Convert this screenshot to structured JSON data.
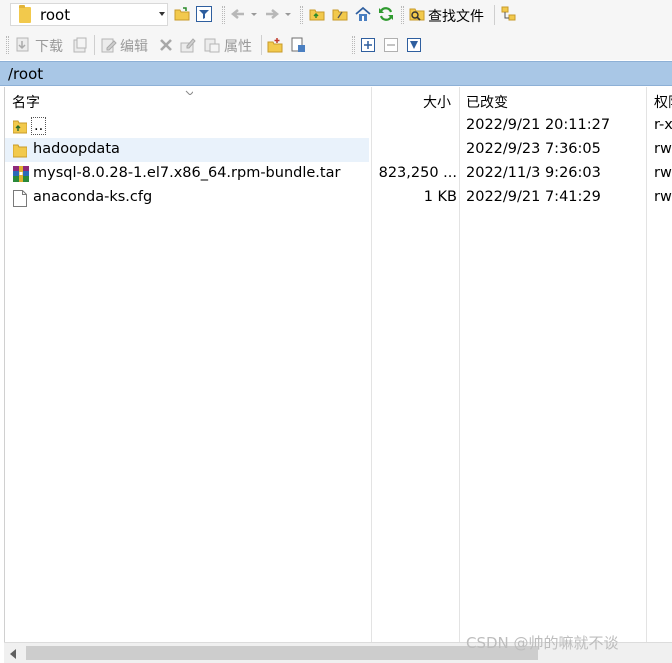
{
  "toolbar": {
    "path_value": "root",
    "find_files_label": "查找文件",
    "download_label": "下载",
    "edit_label": "编辑",
    "properties_label": "属性"
  },
  "address": {
    "path": "/root"
  },
  "columns": {
    "name": "名字",
    "size": "大小",
    "modified": "已改变",
    "permissions": "权限"
  },
  "files": [
    {
      "name": "..",
      "size": "",
      "modified": "2022/9/21 20:11:27",
      "perm": "r-x",
      "icon": "parent-folder-icon"
    },
    {
      "name": "hadoopdata",
      "size": "",
      "modified": "2022/9/23 7:36:05",
      "perm": "rw",
      "icon": "folder-icon"
    },
    {
      "name": "mysql-8.0.28-1.el7.x86_64.rpm-bundle.tar",
      "size": "823,250 ...",
      "modified": "2022/11/3 9:26:03",
      "perm": "rw",
      "icon": "archive-icon"
    },
    {
      "name": "anaconda-ks.cfg",
      "size": "1 KB",
      "modified": "2022/9/21 7:41:29",
      "perm": "rw",
      "icon": "file-icon"
    }
  ],
  "watermark": "CSDN @帅的嘛就不谈",
  "colors": {
    "address_bar": "#a9c7e6",
    "selection": "#e9f2fb",
    "folder": "#f2c94c"
  }
}
